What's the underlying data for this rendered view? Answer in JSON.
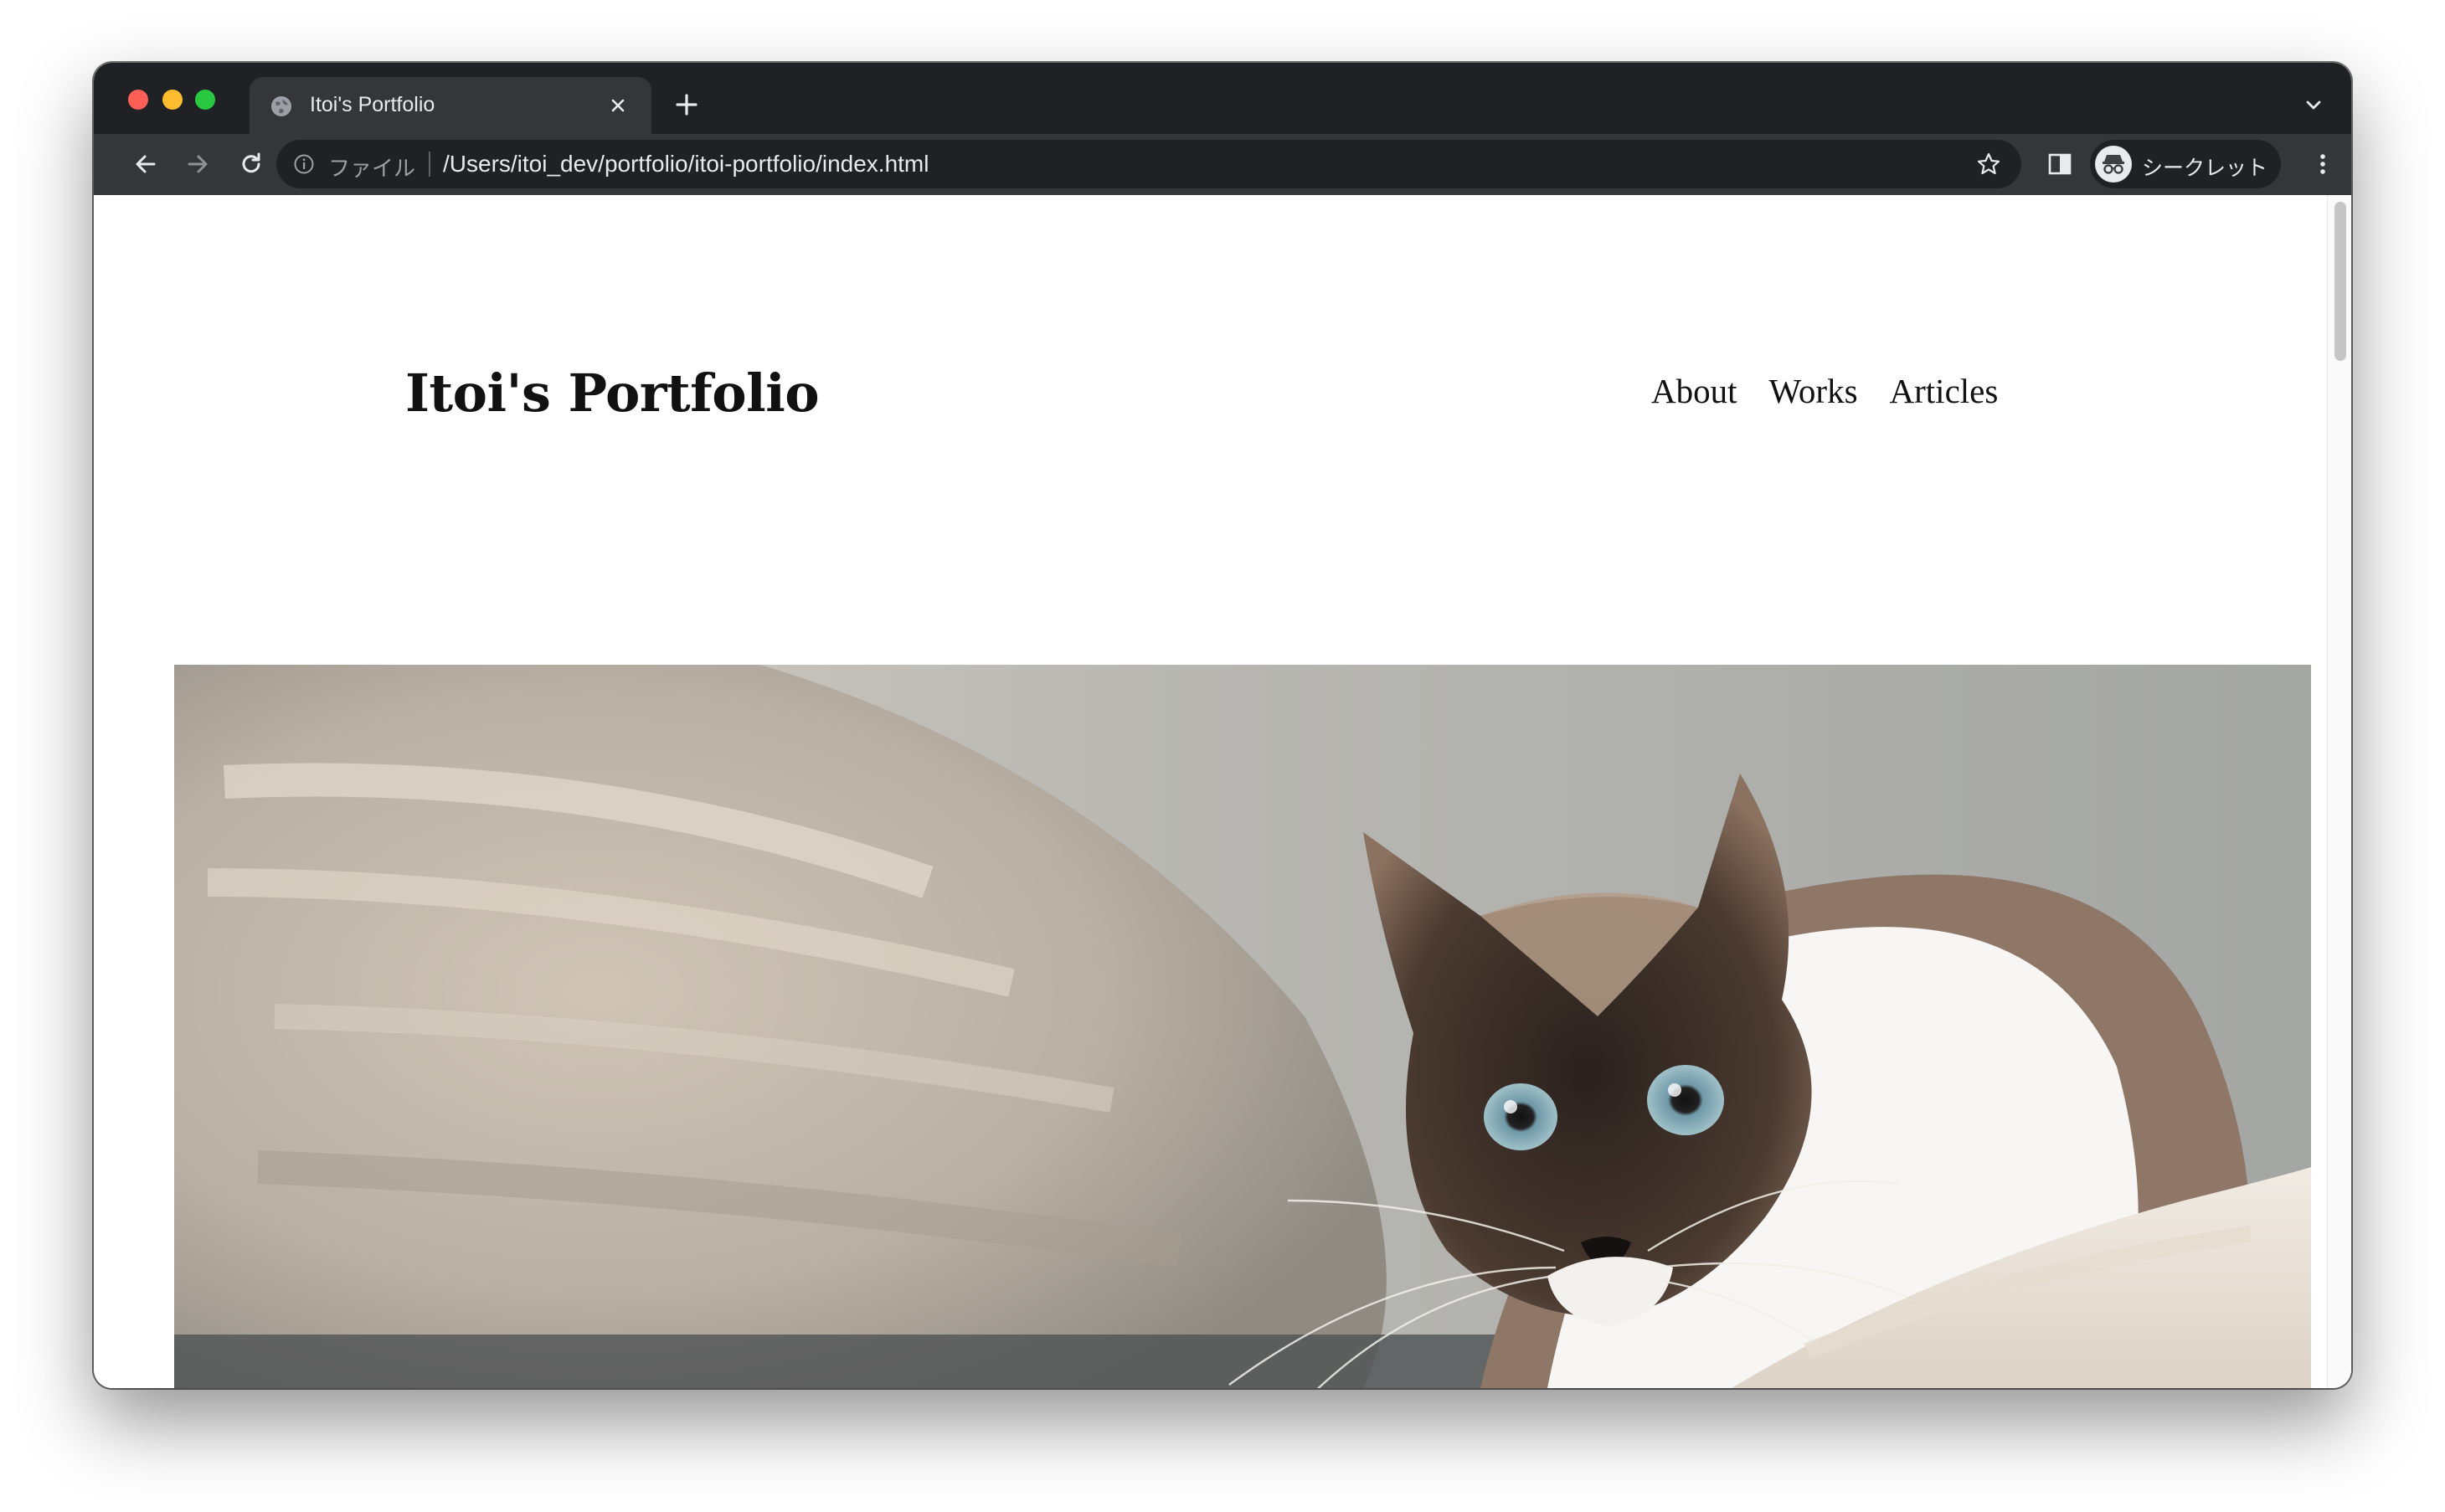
{
  "browser": {
    "tab": {
      "title": "Itoi's Portfolio"
    },
    "address_bar": {
      "scheme_label": "ファイル",
      "url": "/Users/itoi_dev/portfolio/itoi-portfolio/index.html"
    },
    "profile": {
      "label": "シークレット"
    }
  },
  "page": {
    "site_title": "Itoi's Portfolio",
    "nav": [
      {
        "label": "About"
      },
      {
        "label": "Works"
      },
      {
        "label": "Articles"
      }
    ],
    "hero": {
      "icon": "cat-photo"
    }
  },
  "colors": {
    "tabstrip": "#202124",
    "toolbar": "#35363a",
    "omnibox": "#202124",
    "page_text": "#111111"
  }
}
